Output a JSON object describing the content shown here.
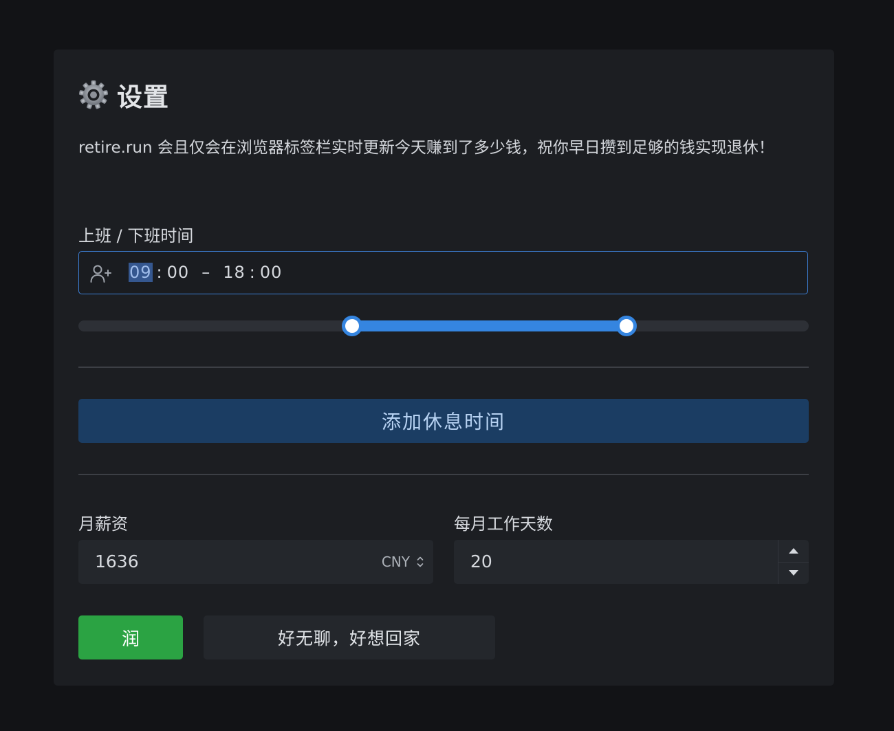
{
  "settings": {
    "title": "设置",
    "description": "retire.run 会且仅会在浏览器标签栏实时更新今天赚到了多少钱，祝你早日攒到足够的钱实现退休！",
    "work_hours": {
      "label": "上班 / 下班时间",
      "start_hour": "09",
      "start_minute": "00",
      "separator": ":",
      "range_dash": "–",
      "end_hour": "18",
      "end_minute": "00",
      "slider_start_fraction": 0.375,
      "slider_end_fraction": 0.75
    },
    "add_break_label": "添加休息时间",
    "salary": {
      "label": "月薪资",
      "value": "1636",
      "currency": "CNY"
    },
    "work_days": {
      "label": "每月工作天数",
      "value": "20"
    },
    "actions": {
      "primary_label": "润",
      "secondary_label": "好无聊，好想回家"
    },
    "colors": {
      "accent": "#3585e0",
      "primary_button": "#2ba343",
      "break_button": "#1b3d63"
    },
    "icons": {
      "title": "gear-icon",
      "time_input": "user-plus-icon",
      "currency": "sort-icon",
      "step_up": "caret-up-icon",
      "step_down": "caret-down-icon"
    }
  }
}
